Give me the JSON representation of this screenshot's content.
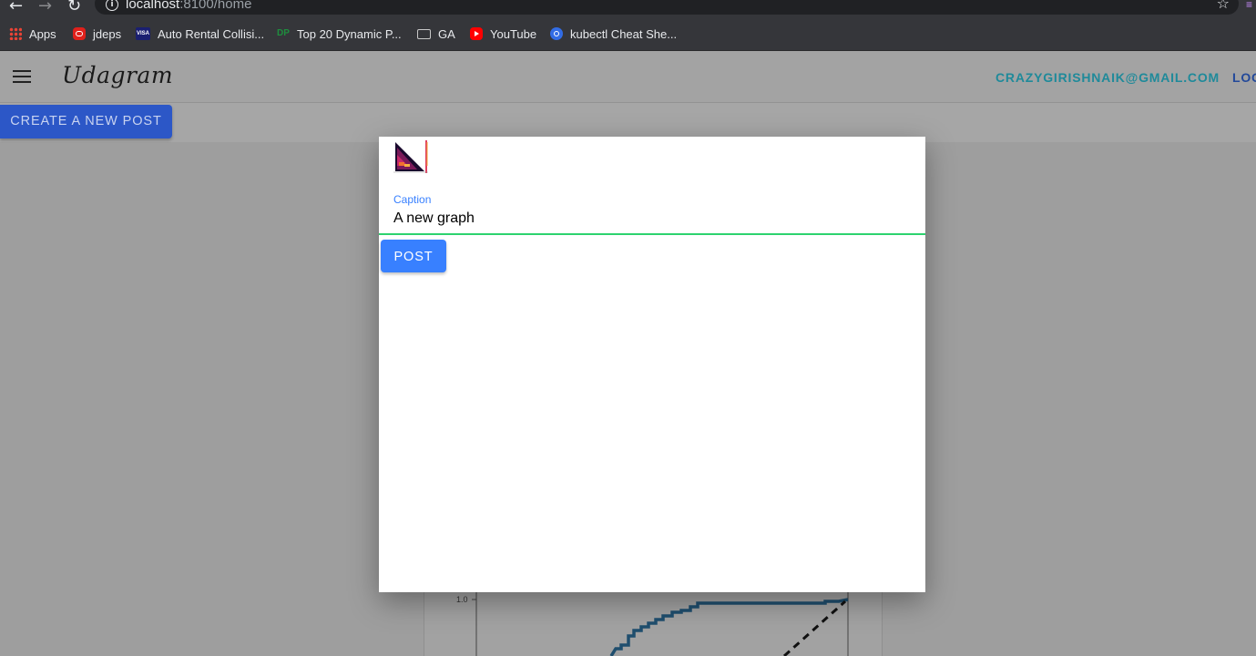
{
  "browser": {
    "url_host": "localhost",
    "url_path": ":8100/home",
    "bookmarks": [
      {
        "label": "Apps",
        "icon": "apps-grid-icon"
      },
      {
        "label": "jdeps",
        "icon": "oracle-icon"
      },
      {
        "label": "Auto Rental Collisi...",
        "icon": "visa-icon"
      },
      {
        "label": "Top 20 Dynamic P...",
        "icon": "dynamic-programming-icon"
      },
      {
        "label": "GA",
        "icon": "folder-icon"
      },
      {
        "label": "YouTube",
        "icon": "youtube-icon"
      },
      {
        "label": "kubectl Cheat She...",
        "icon": "kubernetes-icon"
      }
    ]
  },
  "app": {
    "title": "Udagram",
    "user_email": "CRAZYGIRISHNAIK@GMAIL.COM",
    "logout_label": "LOG",
    "create_post_label": "CREATE A NEW POST"
  },
  "modal": {
    "caption_label": "Caption",
    "caption_value": "A new graph",
    "post_label": "POST"
  },
  "background_chart": {
    "y_tick": "1.0"
  },
  "colors": {
    "primary": "#3880ff",
    "success_underline": "#2dd36f",
    "email_color": "#1f8a9a"
  }
}
